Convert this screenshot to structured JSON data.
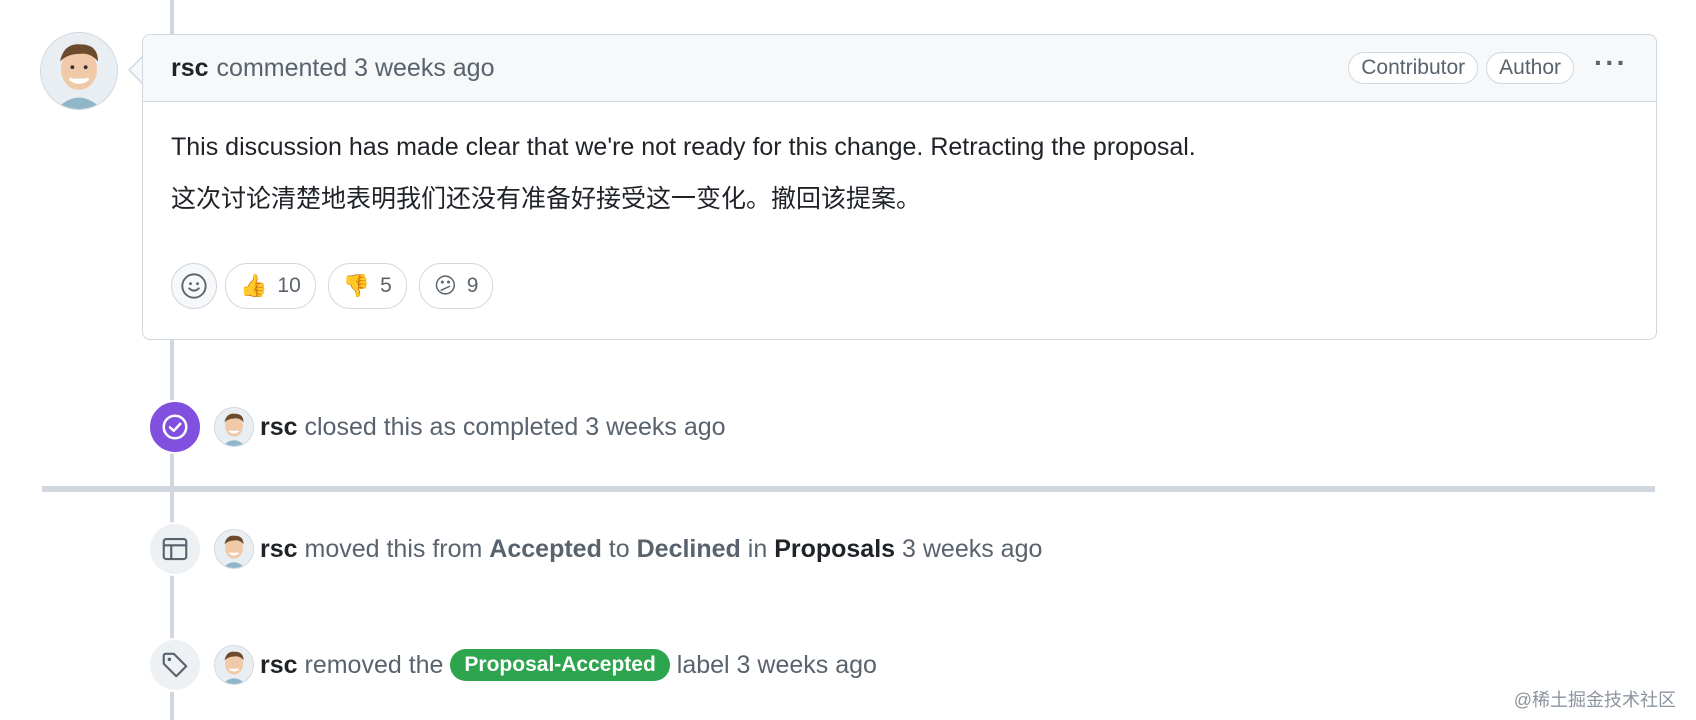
{
  "comment": {
    "author": "rsc",
    "action": "commented",
    "time": "3 weeks ago",
    "badges": [
      "Contributor",
      "Author"
    ],
    "body": [
      "This discussion has made clear that we're not ready for this change. Retracting the proposal.",
      "这次讨论清楚地表明我们还没有准备好接受这一变化。撤回该提案。"
    ],
    "reactions": [
      {
        "emoji": "👍",
        "count": "10"
      },
      {
        "emoji": "👎",
        "count": "5"
      },
      {
        "emoji": "😕",
        "count": "9"
      }
    ]
  },
  "events": {
    "closed": {
      "actor": "rsc",
      "text": "closed this as completed",
      "time": "3 weeks ago"
    },
    "moved": {
      "actor": "rsc",
      "text1": "moved this from",
      "from": "Accepted",
      "text2": "to",
      "to": "Declined",
      "text3": "in",
      "project": "Proposals",
      "time": "3 weeks ago"
    },
    "label": {
      "actor": "rsc",
      "text1": "removed the",
      "label": "Proposal-Accepted",
      "text2": "label",
      "time": "3 weeks ago"
    }
  },
  "colors": {
    "closed_icon": "#8250df",
    "label_green": "#2da44e"
  },
  "watermark": "@稀土掘金技术社区"
}
